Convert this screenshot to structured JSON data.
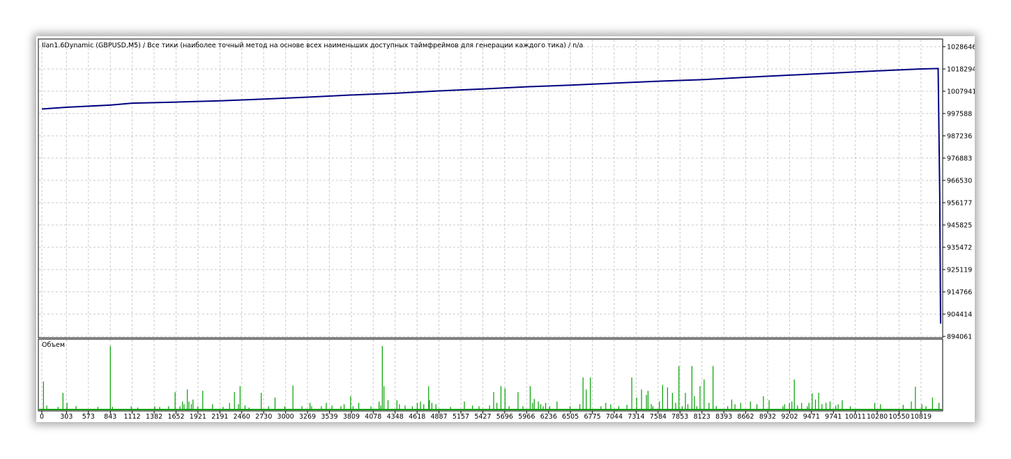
{
  "header": {
    "title": "Ilan1.6Dynamic (GBPUSD,M5) / Все тики (наиболее точный метод на основе всех наименьших доступных таймфреймов для генерации каждого тика) / n/a"
  },
  "volume_panel": {
    "label": "Объем"
  },
  "colors": {
    "balance_line": "#000080",
    "volume_bars": "#00a000",
    "grid": "#c8c8c8",
    "axis": "#000000"
  },
  "chart_data": [
    {
      "type": "line",
      "title": "Ilan1.6Dynamic (GBPUSD,M5) / Все тики (наиболее точный метод на основе всех наименьших доступных таймфреймов для генерации каждого тика) / n/a",
      "series": [
        {
          "x": [
            0,
            303,
            843,
            1112,
            1652,
            2191,
            2730,
            3269,
            3809,
            4348,
            4887,
            5427,
            5966,
            6505,
            7044,
            7584,
            8123,
            8662,
            9202,
            9741,
            10280,
            10819,
            11030,
            11050,
            11060
          ],
          "values": [
            999700,
            1000500,
            1001500,
            1002400,
            1002900,
            1003500,
            1004300,
            1005200,
            1006200,
            1007000,
            1008100,
            1009000,
            1010000,
            1010800,
            1011700,
            1012600,
            1013300,
            1014400,
            1015400,
            1016400,
            1017400,
            1018300,
            1018500,
            960000,
            900000
          ]
        }
      ],
      "xlim": [
        0,
        11060
      ],
      "ylim": [
        894061,
        1028646
      ],
      "y_ticks": [
        "1028646",
        "1018294",
        "1007941",
        "997588",
        "987236",
        "976883",
        "966530",
        "956177",
        "945825",
        "935472",
        "925119",
        "914766",
        "904414",
        "894061"
      ],
      "y_tick_values": [
        1028646,
        1018294,
        1007941,
        997588,
        987236,
        976883,
        966530,
        956177,
        945825,
        935472,
        925119,
        914766,
        904414,
        894061
      ],
      "grid": true
    },
    {
      "type": "bar",
      "title": "Объем",
      "x_ticks": [
        "0",
        "303",
        "573",
        "843",
        "1112",
        "1382",
        "1652",
        "1921",
        "2191",
        "2460",
        "2730",
        "3000",
        "3269",
        "3539",
        "3809",
        "4078",
        "4348",
        "4618",
        "4887",
        "5157",
        "5427",
        "5696",
        "5966",
        "6236",
        "6505",
        "6775",
        "7044",
        "7314",
        "7584",
        "7853",
        "8123",
        "8393",
        "8662",
        "8932",
        "9202",
        "9471",
        "9741",
        "10011",
        "10280",
        "10550",
        "10819"
      ],
      "x_tick_values": [
        0,
        303,
        573,
        843,
        1112,
        1382,
        1652,
        1921,
        2191,
        2460,
        2730,
        3000,
        3269,
        3539,
        3809,
        4078,
        4348,
        4618,
        4887,
        5157,
        5427,
        5696,
        5966,
        6236,
        6505,
        6775,
        7044,
        7314,
        7584,
        7853,
        8123,
        8393,
        8662,
        8932,
        9202,
        9471,
        9741,
        10011,
        10280,
        10550,
        10819
      ],
      "bars": {
        "x": [
          20,
          60,
          200,
          260,
          310,
          420,
          690,
          843,
          870,
          1100,
          1180,
          1390,
          1450,
          1560,
          1640,
          1700,
          1730,
          1750,
          1790,
          1810,
          1840,
          1860,
          1920,
          1980,
          2100,
          2230,
          2310,
          2370,
          2420,
          2440,
          2500,
          2550,
          2700,
          2790,
          2870,
          2990,
          3090,
          3200,
          3300,
          3320,
          3440,
          3500,
          3570,
          3680,
          3720,
          3800,
          3830,
          3900,
          4050,
          4150,
          4170,
          4190,
          4210,
          4260,
          4370,
          4400,
          4470,
          4560,
          4620,
          4660,
          4700,
          4760,
          4770,
          4800,
          4850,
          5030,
          5200,
          5300,
          5380,
          5510,
          5560,
          5600,
          5650,
          5700,
          5750,
          5860,
          5920,
          6010,
          6040,
          6060,
          6110,
          6140,
          6170,
          6200,
          6250,
          6340,
          6500,
          6620,
          6660,
          6700,
          6750,
          6880,
          6940,
          7000,
          7100,
          7200,
          7260,
          7320,
          7380,
          7440,
          7460,
          7500,
          7520,
          7600,
          7640,
          7700,
          7760,
          7800,
          7840,
          7880,
          7920,
          7950,
          8000,
          8030,
          8060,
          8100,
          8150,
          8210,
          8260,
          8300,
          8440,
          8490,
          8530,
          8600,
          8720,
          8800,
          8880,
          8950,
          9120,
          9140,
          9200,
          9230,
          9260,
          9300,
          9350,
          9420,
          9440,
          9480,
          9520,
          9560,
          9600,
          9650,
          9700,
          9770,
          9800,
          9850,
          9950,
          10250,
          10320,
          10600,
          10700,
          10750,
          10830,
          10880,
          10960,
          11040
        ],
        "values": [
          42,
          6,
          4,
          25,
          10,
          5,
          4,
          95,
          4,
          5,
          3,
          5,
          4,
          5,
          26,
          5,
          12,
          8,
          30,
          12,
          8,
          15,
          5,
          28,
          8,
          4,
          10,
          26,
          8,
          35,
          6,
          3,
          25,
          5,
          18,
          5,
          36,
          5,
          10,
          5,
          5,
          10,
          6,
          5,
          8,
          20,
          5,
          10,
          5,
          12,
          6,
          95,
          35,
          14,
          14,
          8,
          6,
          5,
          10,
          12,
          8,
          35,
          14,
          10,
          8,
          4,
          12,
          6,
          5,
          6,
          26,
          10,
          35,
          32,
          5,
          26,
          5,
          35,
          10,
          16,
          12,
          8,
          5,
          10,
          5,
          12,
          5,
          8,
          48,
          30,
          48,
          5,
          10,
          8,
          5,
          7,
          48,
          18,
          30,
          22,
          28,
          8,
          5,
          12,
          37,
          33,
          25,
          10,
          65,
          5,
          25,
          8,
          65,
          20,
          5,
          35,
          45,
          10,
          65,
          5,
          5,
          15,
          8,
          10,
          12,
          8,
          20,
          14,
          5,
          8,
          10,
          12,
          45,
          6,
          10,
          5,
          10,
          24,
          15,
          25,
          8,
          10,
          12,
          6,
          8,
          14,
          5,
          10,
          8,
          7,
          12,
          34,
          8,
          5,
          18,
          10,
          30,
          45
        ]
      },
      "ylim": [
        0,
        100
      ],
      "grid": true
    }
  ]
}
